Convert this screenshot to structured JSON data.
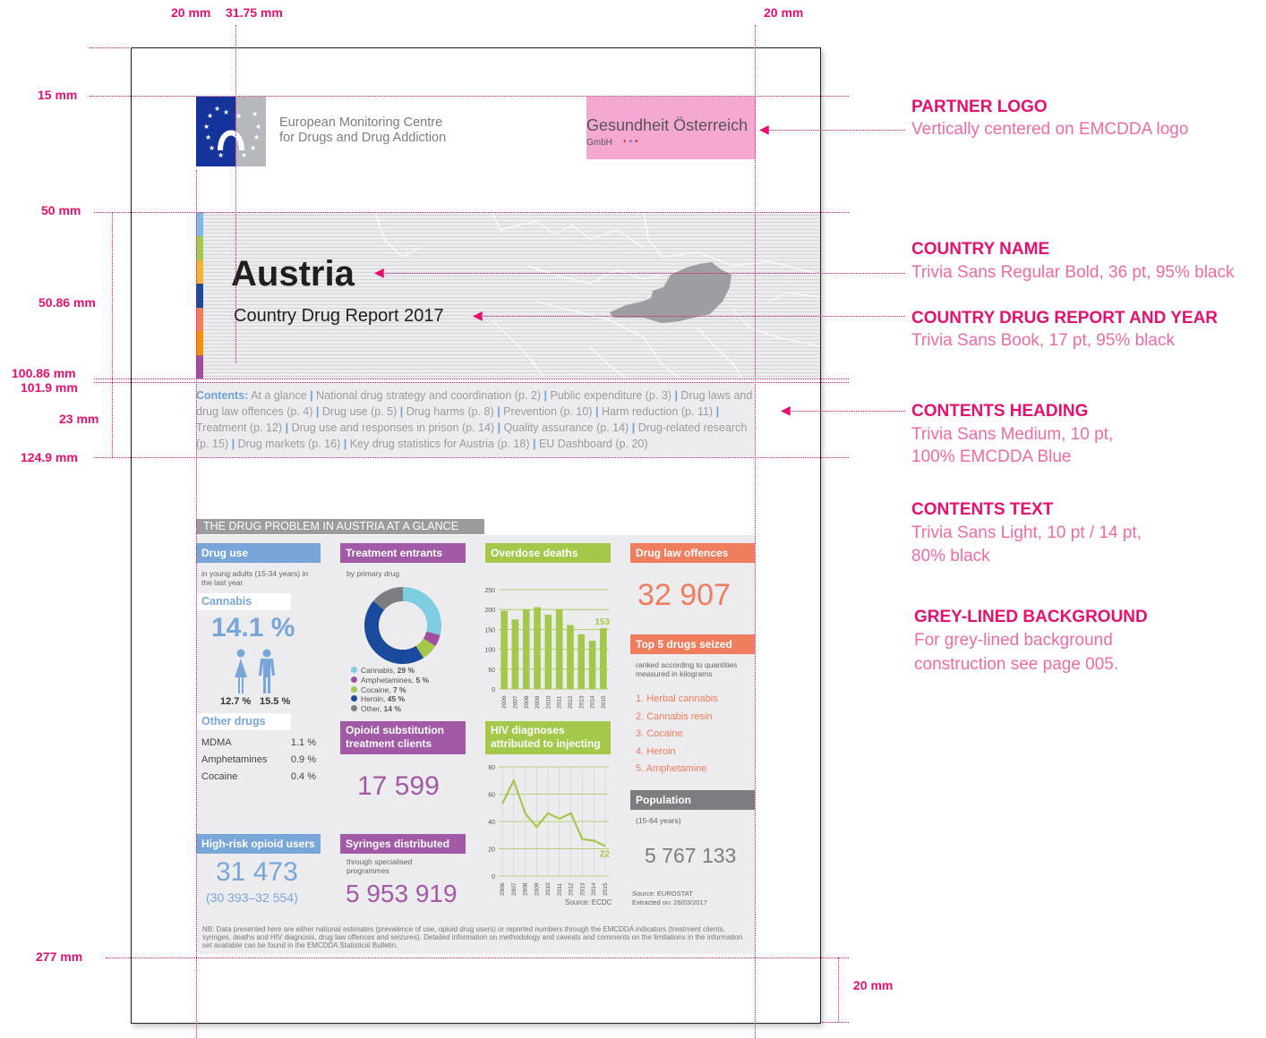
{
  "dimensions": {
    "top_left_margin": "20 mm",
    "top_left_grid": "31.75 mm",
    "top_right_margin": "20 mm",
    "row_15": "15 mm",
    "row_50": "50 mm",
    "row_5086": "50.86 mm",
    "row_10086": "100.86 mm",
    "row_1019": "101.9 mm",
    "row_23": "23 mm",
    "row_1249": "124.9 mm",
    "row_277": "277 mm",
    "bottom_right": "20 mm"
  },
  "logo": {
    "line1": "European Monitoring Centre",
    "line2": "for Drugs and Drug Addiction"
  },
  "partner": {
    "name": "Gesundheit Österreich",
    "sub": "GmbH",
    "dots": "• • •"
  },
  "cover": {
    "country": "Austria",
    "report": "Country Drug Report 2017"
  },
  "contents": {
    "heading": "Contents:",
    "items": [
      "At a glance",
      "National drug strategy and coordination (p. 2)",
      "Public expenditure (p. 3)",
      "Drug laws and drug law offences (p. 4)",
      "Drug use (p. 5)",
      "Drug harms (p. 8)",
      "Prevention (p. 10)",
      "Harm reduction (p. 11)",
      "Treatment (p. 12)",
      "Drug use and responses in prison (p. 14)",
      "Quality assurance (p. 14)",
      "Drug-related research (p. 15)",
      "Drug markets (p. 16)",
      "Key drug statistics for Austria (p. 18)",
      "EU Dashboard (p. 20)"
    ]
  },
  "glance": {
    "title": "THE DRUG PROBLEM IN AUSTRIA AT A GLANCE",
    "drug_use": {
      "header": "Drug use",
      "sub": "in young adults (15-34 years) in the last year",
      "cannabis_label": "Cannabis",
      "cannabis_value": "14.1 %",
      "female": "12.7 %",
      "male": "15.5 %",
      "other_label": "Other drugs",
      "others": [
        {
          "name": "MDMA",
          "value": "1.1 %"
        },
        {
          "name": "Amphetamines",
          "value": "0.9 %"
        },
        {
          "name": "Cocaine",
          "value": "0.4 %"
        }
      ]
    },
    "treatment": {
      "header": "Treatment entrants",
      "sub": "by primary drug",
      "legend": [
        {
          "name": "Cannabis,",
          "value": "29 %",
          "color": "#7fcde0"
        },
        {
          "name": "Amphetamines,",
          "value": "5 %",
          "color": "#a04e9e"
        },
        {
          "name": "Cocaine,",
          "value": "7 %",
          "color": "#a3c84a"
        },
        {
          "name": "Heroin,",
          "value": "45 %",
          "color": "#1a4a9c"
        },
        {
          "name": "Other,",
          "value": "14 %",
          "color": "#7c7d80"
        }
      ]
    },
    "overdose": {
      "header": "Overdose deaths",
      "last_value": "153",
      "y_ticks": [
        "250",
        "200",
        "150",
        "100",
        "50",
        "0"
      ],
      "years": [
        "2006",
        "2007",
        "2008",
        "2009",
        "2010",
        "2011",
        "2012",
        "2013",
        "2014",
        "2015"
      ]
    },
    "offences": {
      "header": "Drug law offences",
      "value": "32 907"
    },
    "top5": {
      "header": "Top 5 drugs seized",
      "sub": "ranked according to quantities measured in kilograms",
      "items": [
        "1. Herbal cannabis",
        "2. Cannabis resin",
        "3. Cocaine",
        "4. Heroin",
        "5. Amphetamine"
      ]
    },
    "opioid": {
      "header1": "Opioid substitution",
      "header2": "treatment clients",
      "value": "17 599"
    },
    "hiv": {
      "header1": "HIV diagnoses",
      "header2": "attributed to injecting",
      "last_value": "22",
      "y_ticks": [
        "80",
        "60",
        "40",
        "20",
        "0"
      ],
      "years": [
        "2006",
        "2007",
        "2008",
        "2009",
        "2010",
        "2011",
        "2012",
        "2013",
        "2014",
        "2015"
      ],
      "source": "Source: ECDC"
    },
    "population": {
      "header": "Population",
      "sub": "(15-64 years)",
      "value": "5 767 133",
      "source1": "Source: EUROSTAT",
      "source2": "Extracted on: 26/03/2017"
    },
    "hro": {
      "header": "High-risk opioid users",
      "value": "31 473",
      "range": "(30 393–32 554)"
    },
    "syringes": {
      "header": "Syringes distributed",
      "sub": "through specialised programmes",
      "value": "5 953 919"
    },
    "note": "NB: Data presented here are either national estimates (prevalence of use, opioid drug users) or reported numbers through the EMCDDA indicators (treatment clients, syringes, deaths and HIV diagnosis, drug law offences and seizures). Detailed information on methodology and caveats and comments on the limitations in the information set available can be found in the EMCDDA Statistical Bulletin."
  },
  "annotations": [
    {
      "heading": "PARTNER LOGO",
      "text": [
        "Vertically centered on EMCDDA logo"
      ]
    },
    {
      "heading": "COUNTRY NAME",
      "text": [
        "Trivia Sans Regular Bold, 36 pt, 95% black"
      ]
    },
    {
      "heading": "COUNTRY DRUG REPORT AND YEAR",
      "text": [
        "Trivia Sans Book, 17 pt, 95% black"
      ]
    },
    {
      "heading": "CONTENTS HEADING",
      "text": [
        "Trivia Sans Medium, 10 pt,",
        "100% EMCDDA Blue"
      ]
    },
    {
      "heading": "CONTENTS TEXT",
      "text": [
        "Trivia Sans Light, 10 pt / 14 pt,",
        "80% black"
      ]
    },
    {
      "heading": "GREY-LINED BACKGROUND",
      "text": [
        "For grey-lined background",
        "construction see page 005."
      ]
    }
  ],
  "chart_data": [
    {
      "type": "bar",
      "title": "Overdose deaths",
      "categories": [
        "2006",
        "2007",
        "2008",
        "2009",
        "2010",
        "2011",
        "2012",
        "2013",
        "2014",
        "2015"
      ],
      "values": [
        197,
        175,
        201,
        206,
        187,
        201,
        161,
        138,
        122,
        153
      ],
      "ylim": [
        0,
        250
      ],
      "color": "#a3c84a"
    },
    {
      "type": "line",
      "title": "HIV diagnoses attributed to injecting",
      "categories": [
        "2006",
        "2007",
        "2008",
        "2009",
        "2010",
        "2011",
        "2012",
        "2013",
        "2014",
        "2015"
      ],
      "values": [
        53,
        70,
        46,
        36,
        46,
        42,
        46,
        27,
        26,
        22
      ],
      "ylim": [
        0,
        80
      ],
      "color": "#a3c84a"
    },
    {
      "type": "pie",
      "title": "Treatment entrants",
      "categories": [
        "Cannabis",
        "Amphetamines",
        "Cocaine",
        "Heroin",
        "Other"
      ],
      "values": [
        29,
        5,
        7,
        45,
        14
      ]
    }
  ]
}
